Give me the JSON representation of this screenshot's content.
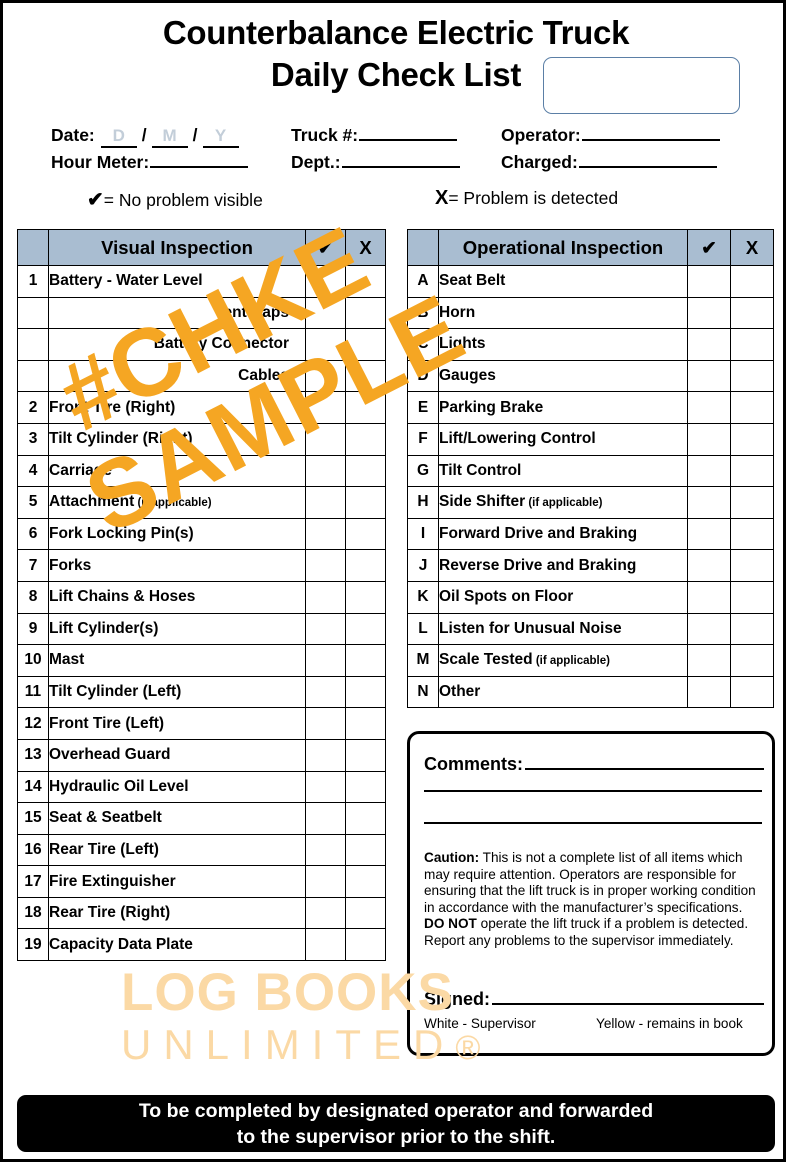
{
  "document": {
    "title_line1": "Counterbalance Electric Truck",
    "title_line2": "Daily Check List",
    "code_box_value": ""
  },
  "meta": {
    "date_label": "Date:",
    "date_day": "D",
    "date_month": "M",
    "date_year": "Y",
    "slash": "/",
    "truck_label": "Truck #:",
    "truck_value": "",
    "operator_label": "Operator:",
    "operator_value": "",
    "hour_meter_label": "Hour Meter:",
    "hour_meter_value": "",
    "dept_label": "Dept.:",
    "dept_value": "",
    "charged_label": "Charged:",
    "charged_value": ""
  },
  "legend": {
    "check_symbol": "✔",
    "check_text": "= No problem visible",
    "x_symbol": "X",
    "x_text": "= Problem is detected"
  },
  "visual_table": {
    "header_index": "",
    "header_name": "Visual Inspection",
    "header_check": "✔",
    "header_x": "X",
    "rows": [
      {
        "index": "1",
        "name": "Battery - Water Level",
        "sub": false
      },
      {
        "index": "",
        "name": "Vent Caps",
        "sub": true
      },
      {
        "index": "",
        "name": "Battery Connector",
        "sub": true
      },
      {
        "index": "",
        "name": "Cables",
        "sub": true
      },
      {
        "index": "2",
        "name": "Front Tire (Right)",
        "sub": false
      },
      {
        "index": "3",
        "name": "Tilt Cylinder (Right)",
        "sub": false
      },
      {
        "index": "4",
        "name": "Carriage",
        "sub": false
      },
      {
        "index": "5",
        "name": "Attachment",
        "note": "(if applicable)",
        "sub": false
      },
      {
        "index": "6",
        "name": "Fork Locking Pin(s)",
        "sub": false
      },
      {
        "index": "7",
        "name": "Forks",
        "sub": false
      },
      {
        "index": "8",
        "name": "Lift Chains & Hoses",
        "sub": false
      },
      {
        "index": "9",
        "name": "Lift Cylinder(s)",
        "sub": false
      },
      {
        "index": "10",
        "name": "Mast",
        "sub": false
      },
      {
        "index": "11",
        "name": "Tilt Cylinder (Left)",
        "sub": false
      },
      {
        "index": "12",
        "name": "Front Tire (Left)",
        "sub": false
      },
      {
        "index": "13",
        "name": "Overhead Guard",
        "sub": false
      },
      {
        "index": "14",
        "name": "Hydraulic Oil Level",
        "sub": false
      },
      {
        "index": "15",
        "name": "Seat & Seatbelt",
        "sub": false
      },
      {
        "index": "16",
        "name": "Rear Tire (Left)",
        "sub": false
      },
      {
        "index": "17",
        "name": "Fire Extinguisher",
        "sub": false
      },
      {
        "index": "18",
        "name": "Rear Tire (Right)",
        "sub": false
      },
      {
        "index": "19",
        "name": "Capacity Data Plate",
        "sub": false
      }
    ]
  },
  "operational_table": {
    "header_index": "",
    "header_name": "Operational Inspection",
    "header_check": "✔",
    "header_x": "X",
    "rows": [
      {
        "index": "A",
        "name": "Seat Belt"
      },
      {
        "index": "B",
        "name": "Horn"
      },
      {
        "index": "C",
        "name": "Lights"
      },
      {
        "index": "D",
        "name": "Gauges"
      },
      {
        "index": "E",
        "name": "Parking Brake"
      },
      {
        "index": "F",
        "name": "Lift/Lowering Control"
      },
      {
        "index": "G",
        "name": "Tilt Control"
      },
      {
        "index": "H",
        "name": "Side Shifter",
        "note": "(if applicable)"
      },
      {
        "index": "I",
        "name": "Forward Drive and Braking"
      },
      {
        "index": "J",
        "name": "Reverse Drive and Braking"
      },
      {
        "index": "K",
        "name": "Oil Spots on Floor"
      },
      {
        "index": "L",
        "name": "Listen for Unusual Noise"
      },
      {
        "index": "M",
        "name": "Scale Tested",
        "note": "(if applicable)"
      },
      {
        "index": "N",
        "name": "Other"
      }
    ]
  },
  "comments": {
    "label": "Comments:",
    "value": "",
    "caution_label": "Caution:",
    "caution_text": " This is not a complete list of all items which may require attention. Operators are responsible for ensuring that the lift truck is in proper working condition in accordance with the manufacturer’s specifications.",
    "donot_label": "DO NOT",
    "donot_text": " operate the lift truck if a problem is detected. Report any problems to the supervisor immediately.",
    "signed_label": "Signed:",
    "signed_value": "",
    "copy_white": "White - Supervisor",
    "copy_yellow": "Yellow - remains in book"
  },
  "footer": {
    "line1": "To be completed by designated operator and forwarded",
    "line2": "to the supervisor prior to the shift."
  },
  "watermarks": {
    "sample_line1": "#CHKE",
    "sample_line2": "SAMPLE",
    "sample_color": "#f5a623",
    "brand_line1": "LOG BOOKS",
    "brand_line2": "UNLIMITED",
    "brand_reg": "®",
    "brand_color": "#fbd9a5"
  },
  "colors": {
    "header_fill": "#a9bdd1",
    "code_box_border": "#5b7fa6",
    "dmy_text": "#c3ced9",
    "footer_bg": "#000000"
  }
}
